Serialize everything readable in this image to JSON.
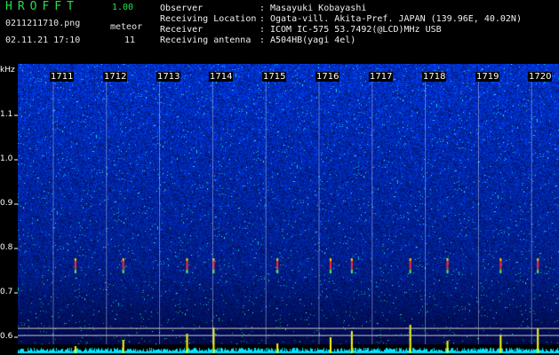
{
  "app": {
    "title": "HROFFT",
    "version": "1.00"
  },
  "file": {
    "name": "0211211710.png",
    "timestamp": "02.11.21 17:10"
  },
  "meteor": {
    "label": "meteor",
    "count": "11"
  },
  "metadata": [
    {
      "key": "Observer",
      "value": "Masayuki Kobayashi"
    },
    {
      "key": "Receiving Location",
      "value": "Ogata-vill. Akita-Pref. JAPAN (139.96E, 40.02N)"
    },
    {
      "key": "Receiver",
      "value": "ICOM IC-575 53.7492(@LCD)MHz USB"
    },
    {
      "key": "Receiving antenna",
      "value": "A504HB(yagi 4el)"
    }
  ],
  "axis": {
    "unit": "kHz",
    "freq_ticks": [
      "1.1",
      "1.0",
      "0.9",
      "0.8",
      "0.7",
      "0.6"
    ],
    "minutes": [
      "1711",
      "1712",
      "1713",
      "1714",
      "1715",
      "1716",
      "1717",
      "1718",
      "1719",
      "1720"
    ]
  },
  "colors": {
    "title": "#22e04a",
    "background": "#000000",
    "noise_base": "#0a1a8c",
    "signal_peak": "#ff2a2a",
    "profile": "#00e5ff",
    "spike": "#ffff00"
  },
  "meteor_events_minutes": [
    1711.4,
    1712.3,
    1713.5,
    1714.0,
    1715.2,
    1716.2,
    1716.6,
    1717.7,
    1718.4,
    1719.4,
    1720.1
  ]
}
